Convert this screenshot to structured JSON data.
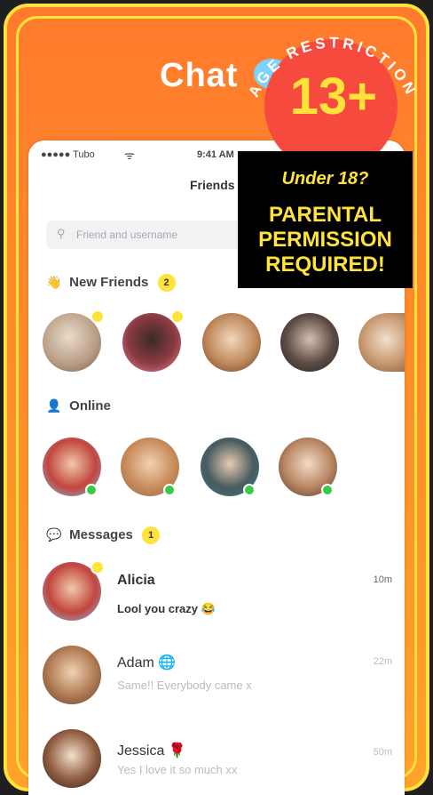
{
  "header": {
    "title": "Chat"
  },
  "status_bar": {
    "carrier": "●●●●● Tubo",
    "wifi": "ᯤ",
    "time": "9:41 AM"
  },
  "nav": {
    "title": "Friends"
  },
  "search": {
    "placeholder": "Friend and username"
  },
  "sections": {
    "new_friends": {
      "label": "New Friends",
      "count": "2",
      "icon": "👋"
    },
    "online": {
      "label": "Online",
      "icon": "👤"
    },
    "messages": {
      "label": "Messages",
      "count": "1",
      "icon": "💬"
    }
  },
  "messages": [
    {
      "name": "Alicia",
      "emoji": "",
      "text": "Lool you crazy 😂",
      "time": "10m"
    },
    {
      "name": "Adam",
      "emoji": "🌐",
      "text": "Same!! Everybody came x",
      "time": "22m"
    },
    {
      "name": "Jessica",
      "emoji": "🌹",
      "text": "Yes I love it so much xx",
      "time": "50m"
    }
  ],
  "age_badge": {
    "arc_text": "AGE RESTRICTION",
    "rating": "13+",
    "question": "Under 18?",
    "line1": "PARENTAL",
    "line2": "PERMISSION",
    "line3": "REQUIRED!"
  },
  "colors": {
    "bg_top": "#ff7a2d",
    "bg_bottom": "#ffa22a",
    "border": "#ffe23a",
    "badge_red": "#f64a3e",
    "online_green": "#3cc94b"
  }
}
